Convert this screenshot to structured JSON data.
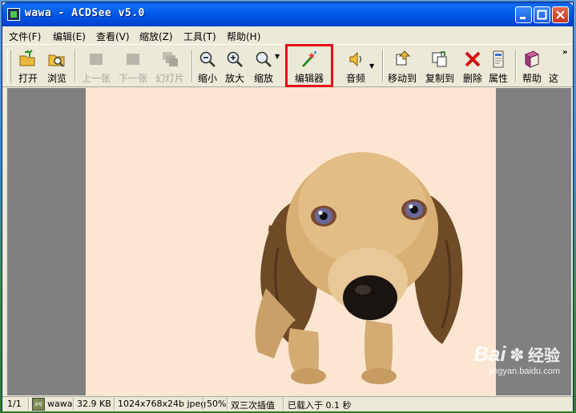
{
  "window": {
    "title": "wawa - ACDSee v5.0"
  },
  "menu": {
    "items": [
      "文件(F)",
      "编辑(E)",
      "查看(V)",
      "缩放(Z)",
      "工具(T)",
      "帮助(H)"
    ]
  },
  "toolbar": {
    "open": "打开",
    "browse": "浏览",
    "prev": "上一张",
    "next": "下一张",
    "slideshow": "幻灯片",
    "zoom_out": "缩小",
    "zoom_in": "放大",
    "zoom": "缩放",
    "editor": "编辑器",
    "audio": "音频",
    "move_to": "移动到",
    "copy_to": "复制到",
    "delete": "删除",
    "properties": "属性",
    "help": "帮助",
    "overflow": "这"
  },
  "status": {
    "index": "1/1",
    "filename": "wawa",
    "filesize": "32.9 KB",
    "dimensions": "1024x768x24b jpeg",
    "zoom": "50%",
    "interpolation": "双三次插值",
    "load_time": "已载入于 0.1 秒"
  },
  "watermark": {
    "brand": "Bai",
    "brand_cn": "经验",
    "url": "jingyan.baidu.com"
  },
  "colors": {
    "titlebar": "#0058e6",
    "highlight": "#e0101a",
    "photo_bg": "#fde6d1",
    "viewer_bg": "#808080"
  }
}
